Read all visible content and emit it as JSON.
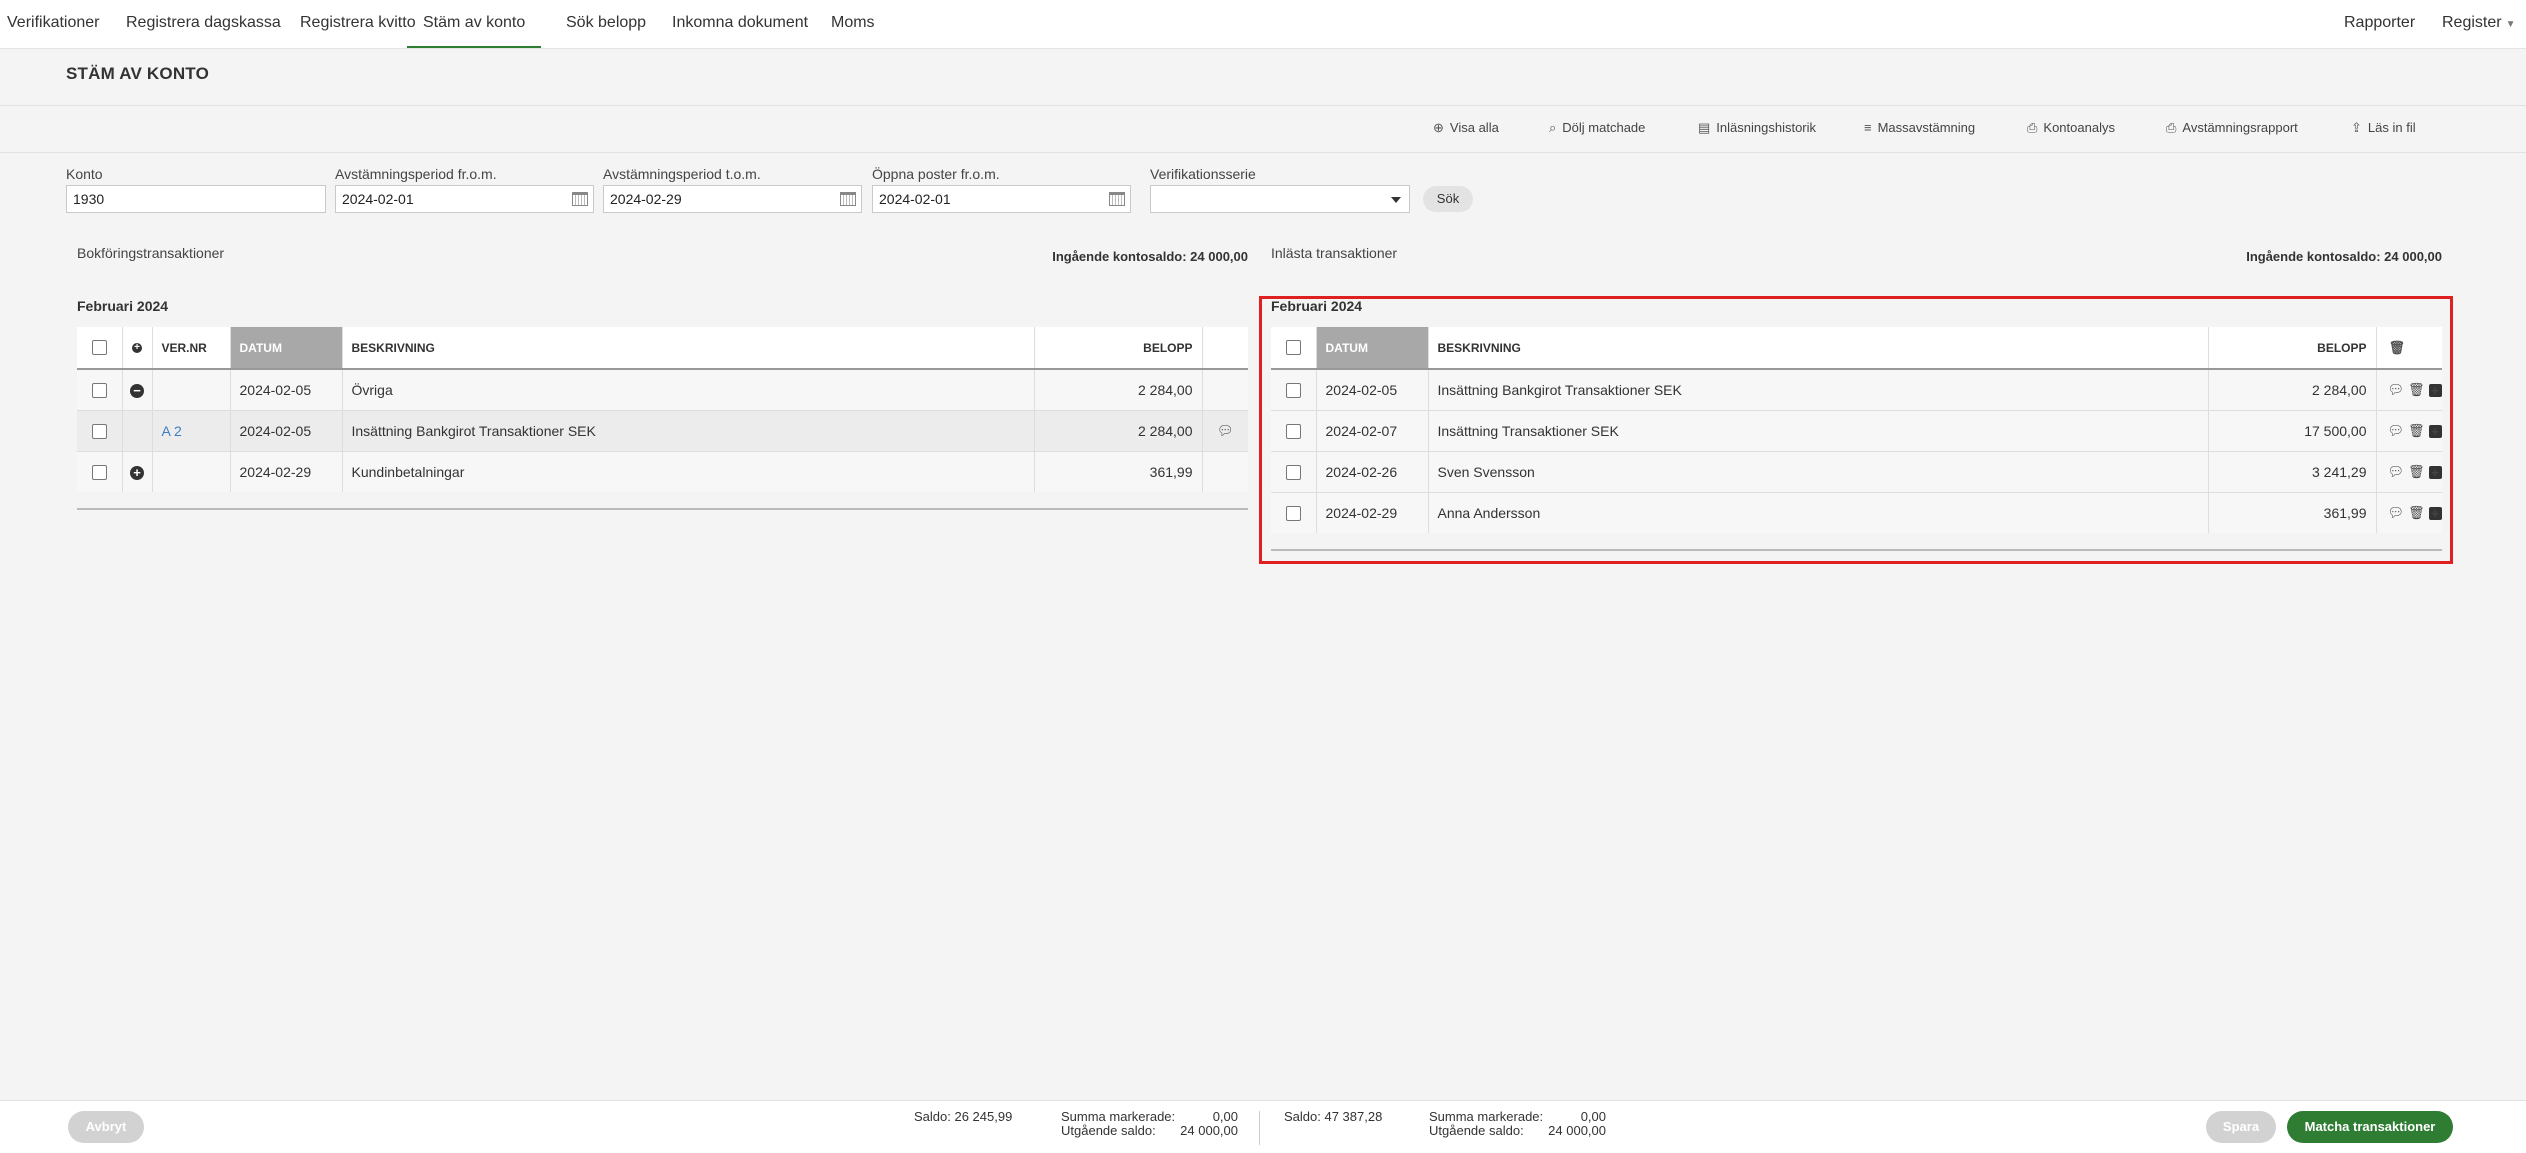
{
  "nav": {
    "items": [
      "Verifikationer",
      "Registrera dagskassa",
      "Registrera kvitto",
      "Stäm av konto",
      "Sök belopp",
      "Inkomna dokument",
      "Moms"
    ],
    "active_index": 3,
    "right": [
      "Rapporter",
      "Register"
    ]
  },
  "page_title": "STÄM AV KONTO",
  "toolbar": {
    "visa_alla": "Visa alla",
    "dolj_matchade": "Dölj matchade",
    "inlasningshistorik": "Inläsningshistorik",
    "massavstamning": "Massavstämning",
    "kontoanalys": "Kontoanalys",
    "avstamningsrapport": "Avstämningsrapport",
    "las_in_fil": "Läs in fil"
  },
  "filters": {
    "konto_label": "Konto",
    "konto_value": "1930",
    "from_label": "Avstämningsperiod fr.o.m.",
    "from_value": "2024-02-01",
    "tom_label": "Avstämningsperiod t.o.m.",
    "tom_value": "2024-02-29",
    "oppna_label": "Öppna poster fr.o.m.",
    "oppna_value": "2024-02-01",
    "serie_label": "Verifikationsserie",
    "serie_value": "",
    "sok_label": "Sök"
  },
  "left": {
    "section_title": "Bokföringstransaktioner",
    "saldo": "Ingående kontosaldo: 24 000,00",
    "month": "Februari 2024",
    "headers": {
      "vernr": "VER.NR",
      "datum": "DATUM",
      "beskrivning": "BESKRIVNING",
      "belopp": "BELOPP"
    },
    "rows": [
      {
        "vernr": "",
        "datum": "2024-02-05",
        "beskrivning": "Övriga",
        "belopp": "2 284,00"
      },
      {
        "vernr": "A 2",
        "datum": "2024-02-05",
        "beskrivning": "Insättning Bankgirot Transaktioner SEK",
        "belopp": "2 284,00"
      },
      {
        "vernr": "",
        "datum": "2024-02-29",
        "beskrivning": "Kundinbetalningar",
        "belopp": "361,99"
      }
    ]
  },
  "right": {
    "section_title": "Inlästa transaktioner",
    "saldo": "Ingående kontosaldo: 24 000,00",
    "month": "Februari 2024",
    "headers": {
      "datum": "DATUM",
      "beskrivning": "BESKRIVNING",
      "belopp": "BELOPP"
    },
    "rows": [
      {
        "datum": "2024-02-05",
        "beskrivning": "Insättning Bankgirot Transaktioner SEK",
        "belopp": "2 284,00"
      },
      {
        "datum": "2024-02-07",
        "beskrivning": "Insättning Transaktioner SEK",
        "belopp": "17 500,00"
      },
      {
        "datum": "2024-02-26",
        "beskrivning": "Sven Svensson",
        "belopp": "3 241,29"
      },
      {
        "datum": "2024-02-29",
        "beskrivning": "Anna Andersson",
        "belopp": "361,99"
      }
    ]
  },
  "footer": {
    "avbryt": "Avbryt",
    "left_saldo": "Saldo: 26 245,99",
    "left_summa_label": "Summa markerade:",
    "left_summa_value": "0,00",
    "left_utg_label": "Utgående saldo:",
    "left_utg_value": "24 000,00",
    "right_saldo": "Saldo: 47 387,28",
    "right_summa_label": "Summa markerade:",
    "right_summa_value": "0,00",
    "right_utg_label": "Utgående saldo:",
    "right_utg_value": "24 000,00",
    "spara": "Spara",
    "matcha": "Matcha transaktioner"
  },
  "colors": {
    "accent_green": "#2e7d32",
    "highlight_red": "#e02020"
  }
}
